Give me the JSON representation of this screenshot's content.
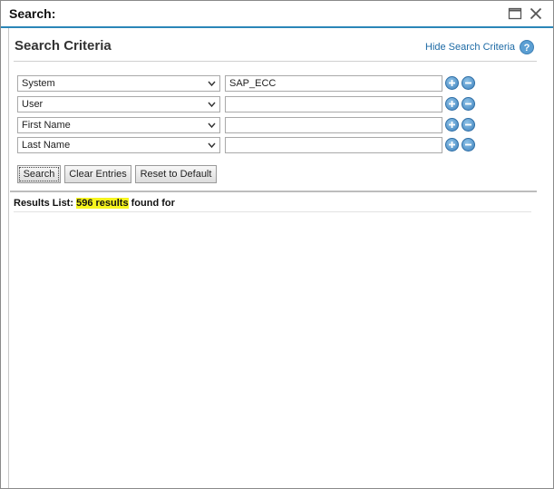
{
  "window": {
    "title": "Search:",
    "maximize_icon": "maximize-icon",
    "close_icon": "close-icon"
  },
  "criteria": {
    "heading": "Search Criteria",
    "hide_link": "Hide Search Criteria",
    "help_icon": "help-icon",
    "help_glyph": "?",
    "rows": [
      {
        "field": "System",
        "value": "SAP_ECC"
      },
      {
        "field": "User",
        "value": ""
      },
      {
        "field": "First Name",
        "value": ""
      },
      {
        "field": "Last Name",
        "value": ""
      }
    ]
  },
  "buttons": {
    "search": "Search",
    "clear": "Clear Entries",
    "reset": "Reset to Default"
  },
  "results": {
    "prefix": "Results List: ",
    "highlight": "596 results",
    "suffix": " found for"
  },
  "colors": {
    "accent": "#2a86b8",
    "link": "#1d6aa5",
    "highlight": "#f6f51e"
  }
}
